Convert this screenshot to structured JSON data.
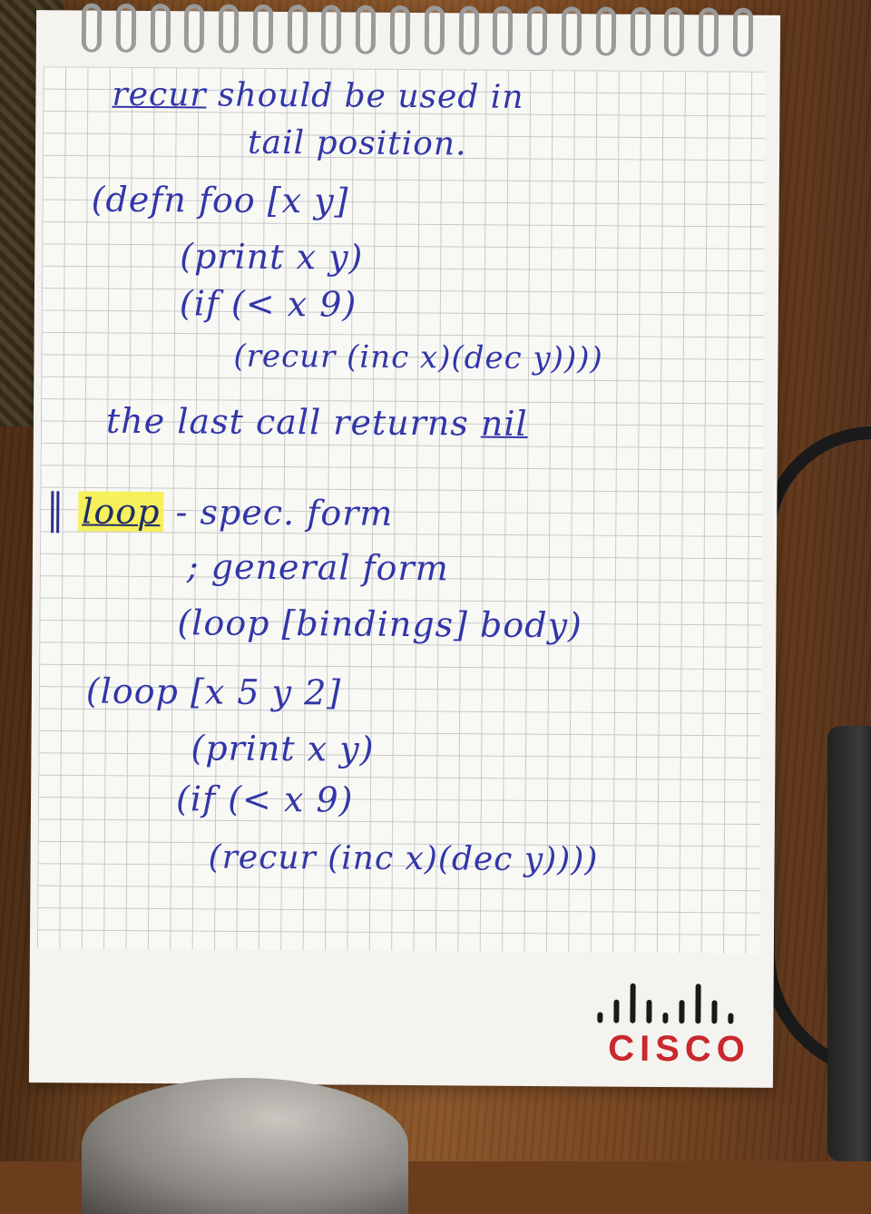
{
  "notes": {
    "lines": [
      "recur should be used in",
      "tail position.",
      "(defn foo [x y]",
      "(print x y)",
      "(if (< x 9)",
      "(recur (inc x)(dec y))))",
      "the last call returns nil",
      "loop - spec. form",
      "; general form",
      "(loop [bindings] body)",
      "(loop [x 5 y 2]",
      "(print x y)",
      "(if (< x 9)",
      "(recur (inc x)(dec y))))"
    ],
    "underlined_words": [
      "recur",
      "nil",
      "loop"
    ],
    "highlighted_word": "loop",
    "ink_color": "#3236a8",
    "highlight_color": "#f6f05a"
  },
  "logo": {
    "name": "cisco-logo",
    "text": "CISCO",
    "text_color": "#c8282e",
    "bars_color": "#1a1a1a"
  }
}
